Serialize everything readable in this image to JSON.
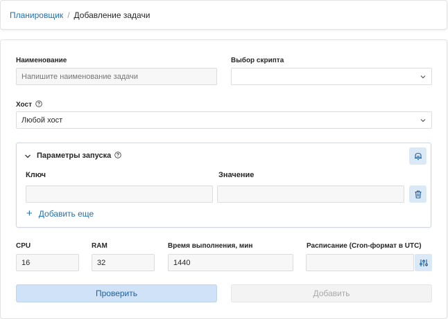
{
  "breadcrumb": {
    "link": "Планировщик",
    "separator": "/",
    "current": "Добавление задачи"
  },
  "form": {
    "name": {
      "label": "Наименование",
      "placeholder": "Напишите наименование задачи"
    },
    "script": {
      "label": "Выбор скрипта",
      "value": ""
    },
    "host": {
      "label": "Хост",
      "value": "Любой хост"
    },
    "launch_params": {
      "title": "Параметры запуска",
      "key_header": "Ключ",
      "value_header": "Значение",
      "key_value": "",
      "value_value": "",
      "add_more": "Добавить еще",
      "add_more_icon": "+"
    },
    "cpu": {
      "label": "CPU",
      "value": "16"
    },
    "ram": {
      "label": "RAM",
      "value": "32"
    },
    "duration": {
      "label": "Время выполнения, мин",
      "value": "1440"
    },
    "schedule": {
      "label": "Расписание (Cron-формат в UTC)",
      "value": ""
    }
  },
  "buttons": {
    "check": "Проверить",
    "add": "Добавить"
  },
  "colors": {
    "link": "#1f6fb2",
    "primary_bg": "#cfe2f7",
    "icon_button_bg": "#dbe8f6",
    "icon_color": "#1f5f99"
  }
}
